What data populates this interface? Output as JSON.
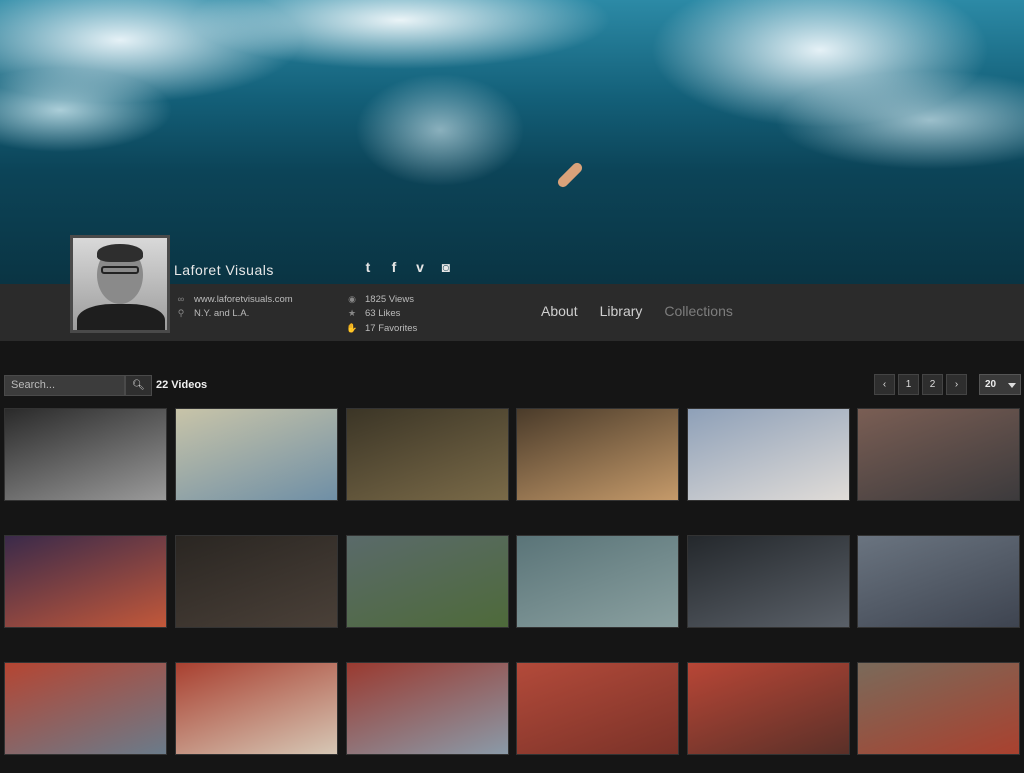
{
  "profile": {
    "name": "Laforet Visuals",
    "website": "www.laforetvisuals.com",
    "location": "N.Y. and L.A.",
    "views": "1825 Views",
    "likes": "63 Likes",
    "favorites": "17 Favorites"
  },
  "social": [
    {
      "icon": "twitter-icon",
      "glyph": "t"
    },
    {
      "icon": "facebook-icon",
      "glyph": "f"
    },
    {
      "icon": "vimeo-icon",
      "glyph": "v"
    },
    {
      "icon": "instagram-icon",
      "glyph": "◙"
    }
  ],
  "nav": {
    "about": "About",
    "library": "Library",
    "collections": "Collections"
  },
  "toolbar": {
    "search_placeholder": "Search...",
    "video_count": "22 Videos",
    "prev": "‹",
    "next": "›",
    "pages": [
      "1",
      "2"
    ],
    "per_page": "20"
  },
  "videos": [
    {
      "scene": "black-and-white men portrait",
      "colors": [
        "#2a2a2a",
        "#9a9a9a"
      ]
    },
    {
      "scene": "blue beetle car",
      "colors": [
        "#c8c4a8",
        "#6f8fa6"
      ]
    },
    {
      "scene": "three people walking at night",
      "colors": [
        "#3b3526",
        "#7a6a48"
      ]
    },
    {
      "scene": "child close-up",
      "colors": [
        "#4a3b2a",
        "#c59a6a"
      ]
    },
    {
      "scene": "people on beach",
      "colors": [
        "#8ea0b8",
        "#e0dcd8"
      ]
    },
    {
      "scene": "coastline at dusk",
      "colors": [
        "#7a5e54",
        "#3c3a3c"
      ]
    },
    {
      "scene": "sunset tufa rocks",
      "colors": [
        "#3a2a4a",
        "#c2583a"
      ]
    },
    {
      "scene": "dark texture",
      "colors": [
        "#2a2622",
        "#4a4038"
      ]
    },
    {
      "scene": "lake landscape",
      "colors": [
        "#5a6a6a",
        "#4e6a3a"
      ]
    },
    {
      "scene": "water surface",
      "colors": [
        "#5a7478",
        "#8aa0a0"
      ]
    },
    {
      "scene": "wet sand",
      "colors": [
        "#24282c",
        "#5a6068"
      ]
    },
    {
      "scene": "cloudy sky",
      "colors": [
        "#6a7480",
        "#3e4450"
      ]
    },
    {
      "scene": "red truck front",
      "colors": [
        "#b54532",
        "#6a7b8a"
      ]
    },
    {
      "scene": "red truck gauges",
      "colors": [
        "#a94030",
        "#d6c7b5"
      ]
    },
    {
      "scene": "red truck mirror",
      "colors": [
        "#9a3a30",
        "#8a9aa8"
      ]
    },
    {
      "scene": "red hose reel",
      "colors": [
        "#b34a3a",
        "#7a3228"
      ]
    },
    {
      "scene": "red truck panel",
      "colors": [
        "#b84636",
        "#5a3028"
      ]
    },
    {
      "scene": "truck with wagon wheel",
      "colors": [
        "#7a6a5a",
        "#a9412f"
      ]
    }
  ]
}
